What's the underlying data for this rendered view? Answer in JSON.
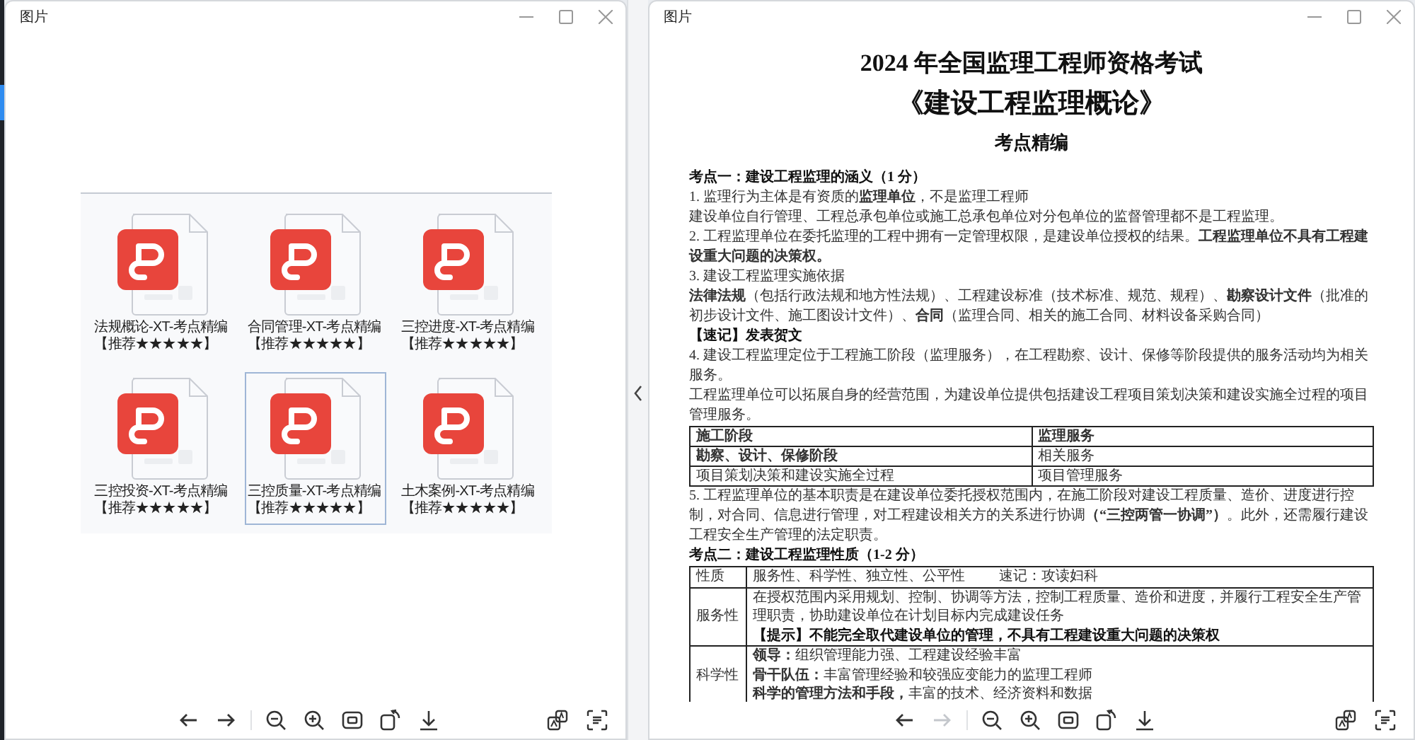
{
  "windows": [
    {
      "title": "图片",
      "kind": "files",
      "files": [
        {
          "label": "法规概论-XT-考点精编【推荐★★★★★】",
          "selected": false
        },
        {
          "label": "合同管理-XT-考点精编【推荐★★★★★】",
          "selected": false
        },
        {
          "label": "三控进度-XT-考点精编【推荐★★★★★】",
          "selected": false
        },
        {
          "label": "三控投资-XT-考点精编【推荐★★★★★】",
          "selected": false
        },
        {
          "label": "三控质量-XT-考点精编【推荐★★★★★】",
          "selected": true
        },
        {
          "label": "土木案例-XT-考点精编【推荐★★★★★】",
          "selected": false
        }
      ],
      "toolbar": [
        {
          "kind": "back",
          "disabled": false
        },
        {
          "kind": "forward",
          "disabled": false
        },
        {
          "kind": "zoom-out",
          "disabled": false
        },
        {
          "kind": "zoom-in",
          "disabled": false
        },
        {
          "kind": "fit",
          "disabled": false
        },
        {
          "kind": "rotate",
          "disabled": false
        },
        {
          "kind": "download",
          "disabled": false
        }
      ],
      "toolbar_end": [
        {
          "kind": "translate",
          "disabled": false
        },
        {
          "kind": "scan",
          "disabled": false
        }
      ]
    },
    {
      "title": "图片",
      "kind": "document",
      "document": {
        "title": "2024 年全国监理工程师资格考试",
        "subtitle": "《建设工程监理概论》",
        "label": "考点精编",
        "blocks": [
          {
            "kind": "heading",
            "text": "考点一：建设工程监理的涵义（1 分）"
          },
          {
            "kind": "para",
            "text": "1. 监理行为主体是有资质的**监理单位**，不是监理工程师"
          },
          {
            "kind": "para",
            "text": "建设单位自行管理、工程总承包单位或施工总承包单位对分包单位的监督管理都不是工程监理。"
          },
          {
            "kind": "para",
            "text": "2. 工程监理单位在委托监理的工程中拥有一定管理权限，是建设单位授权的结果。**工程监理单位不具有工程建设重大问题的决策权。**"
          },
          {
            "kind": "para",
            "text": "3. 建设工程监理实施依据"
          },
          {
            "kind": "para",
            "text": "**法律法规**（包括行政法规和地方性法规）、工程建设标准（技术标准、规范、规程）、**勘察设计文件**（批准的初步设计文件、施工图设计文件）、**合同**（监理合同、相关的施工合同、材料设备采购合同）"
          },
          {
            "kind": "heading",
            "text": "【速记】发表贺文"
          },
          {
            "kind": "para",
            "text": "4. 建设工程监理定位于工程施工阶段（监理服务），在工程勘察、设计、保修等阶段提供的服务活动均为相关服务。"
          },
          {
            "kind": "para",
            "text": "工程监理单位可以拓展自身的经营范围，为建设单位提供包括建设工程项目策划决策和建设实施全过程的项目管理服务。"
          },
          {
            "kind": "grid",
            "rows": [
              [
                "**施工阶段**",
                "**监理服务**"
              ],
              [
                "**勘察、设计、保修阶段**",
                "相关服务"
              ],
              [
                "项目策划决策和建设实施全过程",
                "项目管理服务"
              ]
            ]
          },
          {
            "kind": "para",
            "text": "5. 工程监理单位的基本职责是在建设单位委托授权范围内，在施工阶段对建设工程质量、造价、进度进行控制，对合同、信息进行管理，对工程建设相关方的关系进行协调**（“三控两管一协调”）**。此外，还需履行建设工程安全生产管理的法定职责。"
          },
          {
            "kind": "heading",
            "text": "考点二：建设工程监理性质（1-2 分）"
          },
          {
            "kind": "sheet",
            "rows": [
              {
                "label": "性质",
                "kind": "inline",
                "lines": [
                  {
                    "text": "服务性、科学性、独立性、公平性",
                    "kind": "plain"
                  },
                  {
                    "text": "速记：攻读妇科",
                    "kind": "plain"
                  }
                ]
              },
              {
                "label": "服务性",
                "kind": "stacked",
                "lines": [
                  {
                    "text": "在授权范围内采用规划、控制、协调等方法，控制工程质量、造价和进度，并履行工程安全生产管理职责，协助建设单位在计划目标内完成建设任务",
                    "kind": "plain"
                  },
                  {
                    "text": "【提示】不能完全取代建设单位的管理，不具有工程建设重大问题的决策权",
                    "kind": "emphasis"
                  }
                ]
              },
              {
                "label": "科学性",
                "kind": "stacked",
                "lines": [
                  {
                    "text": "**领导：**组织管理能力强、工程建设经验丰富",
                    "kind": "plain"
                  },
                  {
                    "text": "**骨干队伍：**丰富管理经验和较强应变能力的监理工程师",
                    "kind": "plain"
                  },
                  {
                    "text": "**科学的管理方法和手段，**丰富的技术、经济资料和数据",
                    "kind": "plain"
                  }
                ]
              }
            ]
          }
        ]
      },
      "toolbar": [
        {
          "kind": "back",
          "disabled": false
        },
        {
          "kind": "forward",
          "disabled": true
        },
        {
          "kind": "zoom-out",
          "disabled": false
        },
        {
          "kind": "zoom-in",
          "disabled": false
        },
        {
          "kind": "fit",
          "disabled": false
        },
        {
          "kind": "rotate",
          "disabled": false
        },
        {
          "kind": "download",
          "disabled": false
        }
      ],
      "toolbar_end": [
        {
          "kind": "translate",
          "disabled": false
        },
        {
          "kind": "scan",
          "disabled": false
        }
      ]
    }
  ]
}
